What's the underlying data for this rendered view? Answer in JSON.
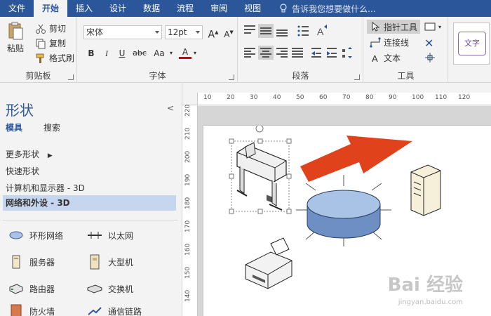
{
  "tabs": [
    "文件",
    "开始",
    "插入",
    "设计",
    "数据",
    "流程",
    "审阅",
    "视图"
  ],
  "active_tab_index": 1,
  "tellme": "告诉我您想要做什么...",
  "clipboard": {
    "paste": "粘贴",
    "cut": "剪切",
    "copy": "复制",
    "format_painter": "格式刷",
    "label": "剪贴板"
  },
  "font": {
    "name": "宋体",
    "size": "12pt",
    "bold": "B",
    "italic": "I",
    "underline": "U",
    "strikethrough": "abc",
    "case": "Aa",
    "color_letter": "A",
    "label": "字体"
  },
  "paragraph": {
    "label": "段落"
  },
  "tools": {
    "pointer": "指针工具",
    "connector": "连接线",
    "text": "文本",
    "label": "工具"
  },
  "style_preview": "文字",
  "shapes_pane": {
    "title": "形状",
    "tab_stencils": "模具",
    "tab_search": "搜索",
    "more_shapes": "更多形状",
    "quick_shapes": "快速形状",
    "stencil_computers": "计算机和显示器 - 3D",
    "stencil_network": "网络和外设 - 3D",
    "items": [
      {
        "label": "环形网络",
        "icon": "ring-network-icon"
      },
      {
        "label": "以太网",
        "icon": "ethernet-icon"
      },
      {
        "label": "服务器",
        "icon": "server-icon"
      },
      {
        "label": "大型机",
        "icon": "mainframe-icon"
      },
      {
        "label": "路由器",
        "icon": "router-icon"
      },
      {
        "label": "交换机",
        "icon": "switch-icon"
      },
      {
        "label": "防火墙",
        "icon": "firewall-icon"
      },
      {
        "label": "通信链路",
        "icon": "comm-link-icon"
      }
    ]
  },
  "hruler_labels": [
    "10",
    "20",
    "30",
    "40",
    "50",
    "60",
    "70",
    "80",
    "90",
    "100",
    "110",
    "120"
  ],
  "vruler_labels": [
    "220",
    "210",
    "200",
    "190",
    "180",
    "170",
    "160",
    "150",
    "140"
  ],
  "watermark": "Bai 经验",
  "watermark_sub": "jingyan.baidu.com",
  "colors": {
    "brand": "#2b579a",
    "arrow": "#e0431c",
    "selected_stencil": "#c7d6ef",
    "ring_top": "#a9c3e6",
    "ring_side": "#6e8fc4"
  }
}
